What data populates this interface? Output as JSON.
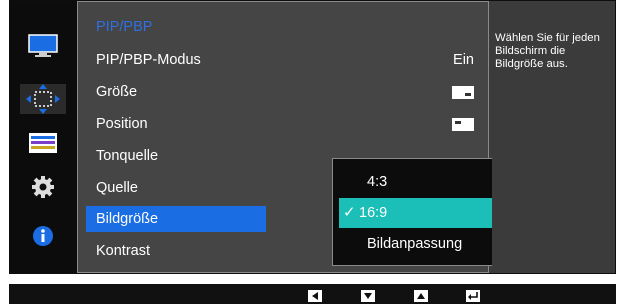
{
  "menu": {
    "title": "PIP/PBP",
    "items": [
      {
        "label": "PIP/PBP-Modus",
        "value": "Ein"
      },
      {
        "label": "Größe"
      },
      {
        "label": "Position"
      },
      {
        "label": "Tonquelle"
      },
      {
        "label": "Quelle"
      },
      {
        "label": "Bildgröße"
      },
      {
        "label": "Kontrast"
      }
    ]
  },
  "submenu": {
    "options": [
      "4:3",
      "16:9",
      "Bildanpassung"
    ],
    "selected": "16:9"
  },
  "help": {
    "text": "Wählen Sie für jeden Bildschirm die Bildgröße aus."
  },
  "sidebar": {
    "icons": [
      "picture-icon",
      "onscreen-display-icon",
      "system-icon",
      "settings-gear-icon",
      "information-icon"
    ]
  },
  "colors": {
    "accent_blue": "#1a6de3",
    "title_blue": "#2f6fe0",
    "selected_teal": "#1bbfb8",
    "panel_gray": "#454545",
    "osd_bg": "#3b3b3b"
  },
  "nav_buttons": [
    "left-icon",
    "down-icon",
    "up-icon",
    "enter-icon"
  ]
}
